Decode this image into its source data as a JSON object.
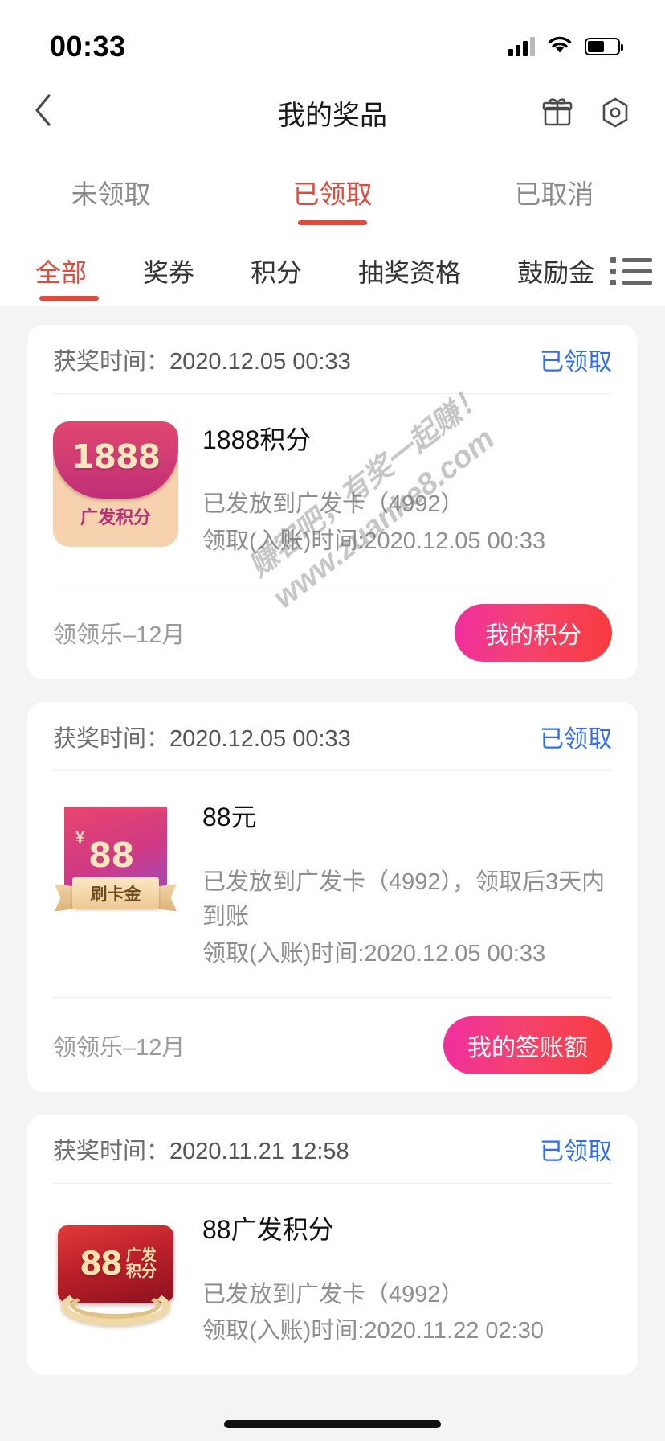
{
  "status_bar": {
    "time": "00:33",
    "signal_icon": "cellular-signal-icon",
    "wifi_icon": "wifi-icon",
    "battery_icon": "battery-icon"
  },
  "nav": {
    "back_icon": "chevron-left-icon",
    "title": "我的奖品",
    "gift_icon": "gift-icon",
    "settings_icon": "hexagon-target-icon"
  },
  "primary_tabs": [
    {
      "label": "未领取",
      "active": false
    },
    {
      "label": "已领取",
      "active": true
    },
    {
      "label": "已取消",
      "active": false
    }
  ],
  "secondary_tabs": [
    {
      "label": "全部",
      "active": true
    },
    {
      "label": "奖券",
      "active": false
    },
    {
      "label": "积分",
      "active": false
    },
    {
      "label": "抽奖资格",
      "active": false
    },
    {
      "label": "鼓励金",
      "active": false
    }
  ],
  "list_toggle_icon": "list-view-icon",
  "colors": {
    "accent_red": "#e14b3c",
    "status_blue": "#2f6ef0",
    "button_gradient_start": "#ef2fa0",
    "button_gradient_end": "#f63c3c",
    "page_background": "#f4f4f4"
  },
  "cards": [
    {
      "time_label": "获奖时间：",
      "time_value": "2020.12.05 00:33",
      "status": "已领取",
      "thumb_icon": "points-envelope-icon",
      "thumb_amount": "1888",
      "thumb_caption": "广发积分",
      "title": "1888积分",
      "desc_lines": [
        "已发放到广发卡（4992）",
        "领取(入账)时间:2020.12.05 00:33"
      ],
      "foot_label": "领领乐–12月",
      "foot_button": "我的积分"
    },
    {
      "time_label": "获奖时间：",
      "time_value": "2020.12.05 00:33",
      "status": "已领取",
      "thumb_icon": "cashback-ticket-icon",
      "thumb_currency": "¥",
      "thumb_amount": "88",
      "thumb_caption": "刷卡金",
      "title": "88元",
      "desc_lines": [
        "已发放到广发卡（4992），领取后3天内到账",
        "领取(入账)时间:2020.12.05 00:33"
      ],
      "foot_label": "领领乐–12月",
      "foot_button": "我的签账额"
    },
    {
      "time_label": "获奖时间：",
      "time_value": "2020.11.21 12:58",
      "status": "已领取",
      "thumb_icon": "points-medal-icon",
      "thumb_amount": "88",
      "thumb_caption_line1": "广发",
      "thumb_caption_line2": "积分",
      "title": "88广发积分",
      "desc_lines": [
        "已发放到广发卡（4992）",
        "领取(入账)时间:2020.11.22 02:30"
      ]
    }
  ],
  "watermark": {
    "line1": "赚客吧，有奖一起赚！",
    "line2": "www.zuanke8.com"
  }
}
